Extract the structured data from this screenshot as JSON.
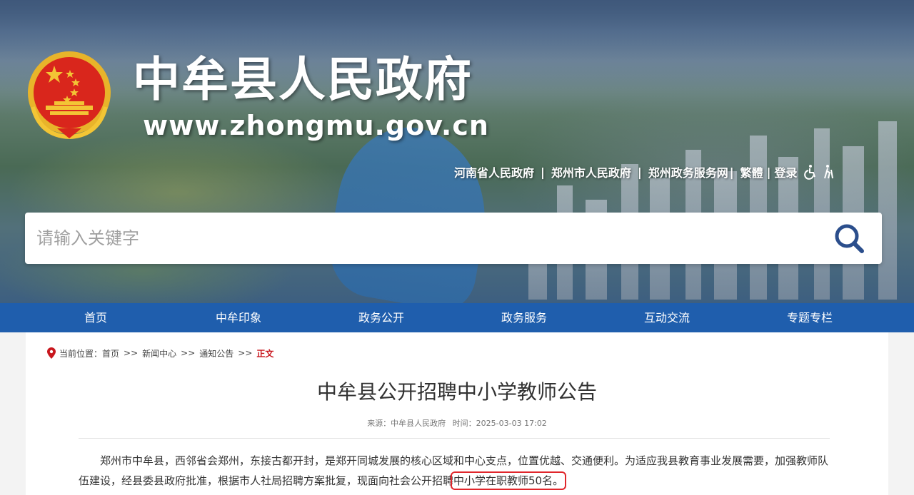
{
  "header": {
    "site_title": "中牟县人民政府",
    "site_url": "www.zhongmu.gov.cn",
    "top_links": [
      "河南省人民政府",
      "郑州市人民政府",
      "郑州政务服务网",
      "繁體",
      "登录"
    ],
    "separator": "|",
    "accessibility_icons": [
      "wheelchair-icon",
      "elderly-icon"
    ]
  },
  "search": {
    "placeholder": "请输入关键字",
    "icon": "search-icon"
  },
  "nav": {
    "items": [
      "首页",
      "中牟印象",
      "政务公开",
      "政务服务",
      "互动交流",
      "专题专栏"
    ]
  },
  "breadcrumb": {
    "prefix": "当前位置：",
    "items": [
      "首页",
      "新闻中心",
      "通知公告"
    ],
    "arrow": ">>",
    "current": "正文"
  },
  "article": {
    "title": "中牟县公开招聘中小学教师公告",
    "source": "来源：中牟县人民政府",
    "time": "时间：2025-03-03 17:02",
    "paragraph_main": "郑州市中牟县，西邻省会郑州，东接古都开封，是郑开同城发展的核心区域和中心支点，位置优越、交通便利。为适应我县教育事业发展需要，加强教师队伍建设，经县委县政府批准，根据市人社局招聘方案批复，现面向社会公开招聘",
    "paragraph_highlight": "中小学在职教师50名。"
  },
  "colors": {
    "nav_bg": "#1f5ead",
    "breadcrumb_current": "#c8161d",
    "highlight_box": "#e0262b",
    "search_icon": "#2b4e8c"
  }
}
